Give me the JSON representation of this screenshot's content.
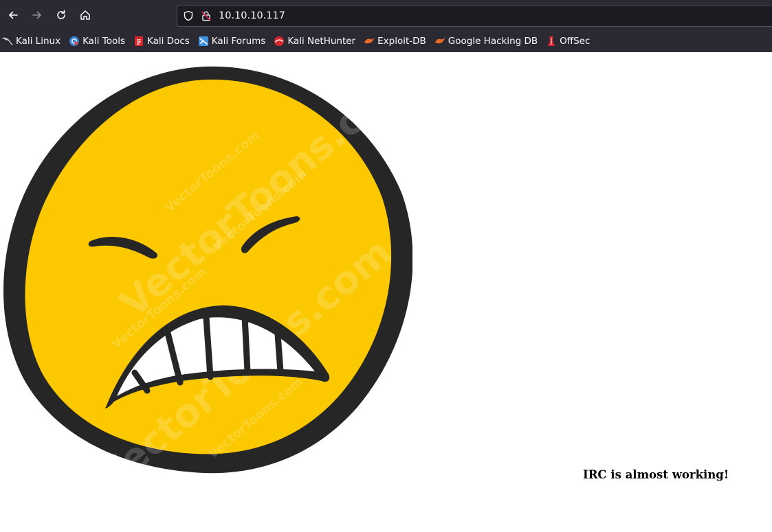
{
  "browser": {
    "url": "10.10.10.117",
    "colors": {
      "chrome_bg": "#2b2a33",
      "url_bar_bg": "#1c1b22",
      "text": "#fbfbfe"
    },
    "bookmarks": [
      {
        "label": "Kali Linux",
        "icon": "kali-dragon-icon"
      },
      {
        "label": "Kali Tools",
        "icon": "kali-tools-icon"
      },
      {
        "label": "Kali Docs",
        "icon": "kali-docs-icon"
      },
      {
        "label": "Kali Forums",
        "icon": "kali-forums-icon"
      },
      {
        "label": "Kali NetHunter",
        "icon": "kali-nethunter-icon"
      },
      {
        "label": "Exploit-DB",
        "icon": "exploit-db-icon"
      },
      {
        "label": "Google Hacking DB",
        "icon": "ghdb-icon"
      },
      {
        "label": "OffSec",
        "icon": "offsec-icon"
      }
    ]
  },
  "page": {
    "image": {
      "icon": "angry-face-icon",
      "face_color": "#fcc800",
      "outline_color": "#262626",
      "watermark": "VectorToons.com"
    },
    "message": "IRC is almost working!"
  }
}
